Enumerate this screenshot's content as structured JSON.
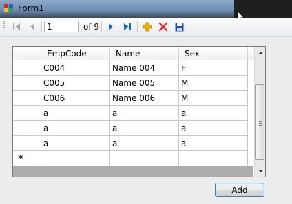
{
  "window": {
    "title": "Form1"
  },
  "navigator": {
    "position": "1",
    "count_label": "of 9"
  },
  "grid": {
    "columns": [
      "EmpCode",
      "Name",
      "Sex"
    ],
    "rows": [
      [
        "C004",
        "Name 004",
        "F"
      ],
      [
        "C005",
        "Name 005",
        "M"
      ],
      [
        "C006",
        "Name 006",
        "M"
      ],
      [
        "a",
        "a",
        "a"
      ],
      [
        "a",
        "a",
        "a"
      ],
      [
        "a",
        "a",
        "a"
      ]
    ],
    "new_row_marker": "*"
  },
  "actions": {
    "add_label": "Add"
  },
  "icons": {
    "move_first": "move-first-icon",
    "move_previous": "move-previous-icon",
    "move_next": "move-next-icon",
    "move_last": "move-last-icon",
    "add_new": "add-new-icon",
    "delete": "delete-icon",
    "save": "save-icon"
  },
  "colors": {
    "nav_disabled": "#a7a7a7",
    "nav_active": "#1f66c9",
    "add_icon": "#f5b400",
    "delete_icon": "#e03a2f",
    "save_icon": "#1e4fa3"
  }
}
